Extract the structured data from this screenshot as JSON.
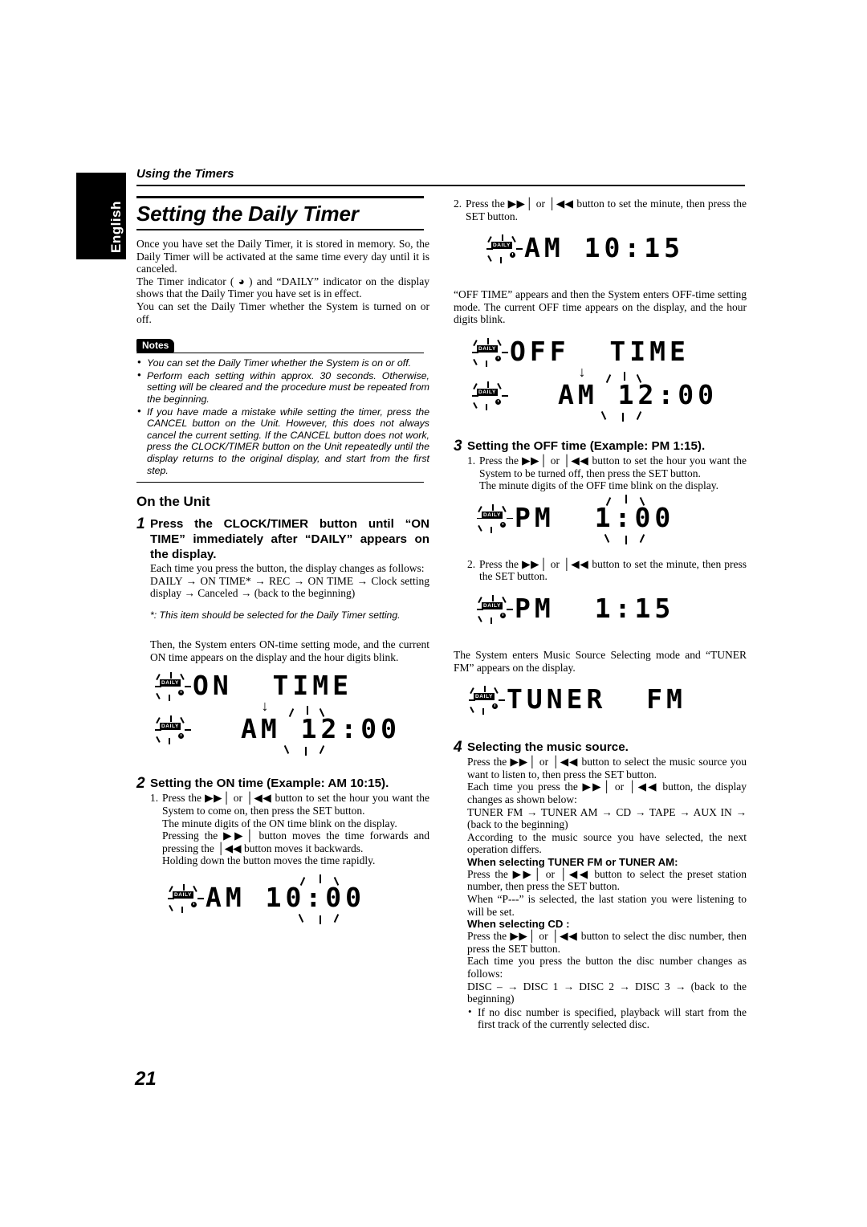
{
  "meta": {
    "language_tab": "English",
    "running_head": "Using the Timers",
    "page_number": "21"
  },
  "left_column": {
    "title": "Setting the Daily Timer",
    "intro_paragraphs": [
      "Once you have set the Daily Timer, it is stored in memory. So, the Daily Timer will be activated at the same time every day until it is canceled.",
      "The Timer indicator ( ◕ ) and “DAILY” indicator on the display shows that the Daily Timer you have set is in effect.",
      "You can set the Daily Timer whether the System is turned on or off."
    ],
    "notes_badge": "Notes",
    "notes": [
      "You can set the Daily Timer whether the System is on or off.",
      "Perform each setting within approx. 30 seconds. Otherwise, setting will be cleared and the procedure must be repeated from the beginning.",
      "If you have made a mistake while setting the timer, press the CANCEL button on the Unit. However, this does not always cancel the current setting. If the CANCEL button does not work, press the CLOCK/TIMER button on the Unit repeatedly until the display returns to the original display, and start from the first step."
    ],
    "subhead": "On the Unit",
    "step1": {
      "number": "1",
      "title": "Press the CLOCK/TIMER button until “ON TIME” immediately after “DAILY” appears on the display.",
      "body1": "Each time you press the button, the display changes as follows:",
      "sequence": "DAILY → ON TIME* → REC → ON TIME → Clock setting display → Canceled → (back to the beginning)",
      "footnote": "*: This item should be selected for the Daily Timer setting.",
      "body2": "Then, the System enters ON-time setting mode, and the current ON time appears on the display and the hour digits blink."
    },
    "lcd_on_time": {
      "indicator": "DAILY",
      "line1": "ON  TIME",
      "arrow": "↓",
      "line2": "AM 12:00",
      "blink_part": "12"
    },
    "step2": {
      "number": "2",
      "title": "Setting the ON time (Example: AM 10:15).",
      "sub1_num": "1.",
      "sub1_text": "Press the ▶▶│ or │◀◀ button to set the hour you want the System to come on, then press the SET button.",
      "sub1_detail1": "The minute digits of the ON time blink on the display.",
      "sub1_detail2": "Pressing the ▶▶│ button moves the time forwards and pressing the │◀◀ button moves it backwards.",
      "sub1_detail3": "Holding down the button moves the time rapidly."
    },
    "lcd_am_10_00": {
      "indicator": "DAILY",
      "line": "AM 10:00",
      "blink_part": "00"
    }
  },
  "right_column": {
    "step2_continued": {
      "sub2_num": "2.",
      "sub2_text": "Press the ▶▶│ or │◀◀ button to set the minute, then press the SET button."
    },
    "lcd_am_10_15": {
      "indicator": "DAILY",
      "line": "AM 10:15"
    },
    "after_on_time_text": "“OFF TIME” appears and then the System enters OFF-time setting mode. The current OFF time appears on the display, and the hour digits blink.",
    "lcd_off_time": {
      "indicator": "DAILY",
      "line1": "OFF  TIME",
      "arrow": "↓",
      "line2": "AM 12:00",
      "blink_part": "12"
    },
    "step3": {
      "number": "3",
      "title": "Setting the OFF time (Example: PM 1:15).",
      "sub1_num": "1.",
      "sub1_text": "Press the ▶▶│ or │◀◀ button to set the hour you want the System to be turned off, then press the SET button.",
      "sub1_detail": "The minute digits of the OFF time blink on the display.",
      "sub2_num": "2.",
      "sub2_text": "Press the ▶▶│ or │◀◀ button to set the minute, then press the SET button."
    },
    "lcd_pm_1_00": {
      "indicator": "DAILY",
      "line_prefix": "PM",
      "line_time": "1:00",
      "blink_part": "1:00"
    },
    "lcd_pm_1_15": {
      "indicator": "DAILY",
      "line_prefix": "PM",
      "line_time": "1:15"
    },
    "after_off_time_text": "The System enters Music Source Selecting mode and “TUNER FM” appears on the display.",
    "lcd_tuner_fm": {
      "indicator": "DAILY",
      "line": "TUNER  FM"
    },
    "step4": {
      "number": "4",
      "title": "Selecting the music source.",
      "body1": "Press the ▶▶│ or │◀◀ button to select the music source you want to listen to, then press the SET button.",
      "body2": "Each time you press the ▶▶│ or │◀◀ button, the display changes as shown below:",
      "sequence": "TUNER FM → TUNER AM → CD → TAPE → AUX IN → (back to the beginning)",
      "body3": "According to the music source you have selected, the next operation differs.",
      "tuner_head": "When selecting TUNER FM or TUNER AM:",
      "tuner_body1": "Press the ▶▶│ or │◀◀ button to select the preset station number, then press the SET button.",
      "tuner_body2": "When “P---” is selected, the last station you were listening to will be set.",
      "cd_head": "When selecting CD :",
      "cd_body1": "Press the ▶▶│ or │◀◀ button to select the disc number, then press the SET button.",
      "cd_body2": "Each time you press the button the disc number changes as follows:",
      "cd_sequence": "DISC – → DISC 1 → DISC 2 → DISC 3 → (back to the beginning)",
      "cd_bullet": "If no disc number is specified, playback will start from the first track of the currently selected disc."
    }
  }
}
